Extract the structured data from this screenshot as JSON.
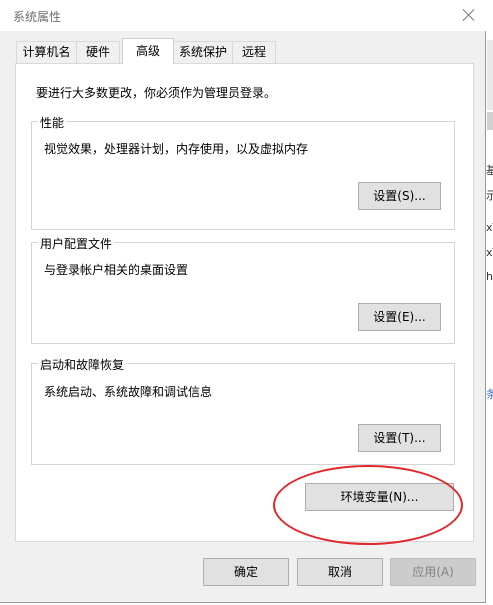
{
  "window": {
    "title": "系统属性"
  },
  "tabs": [
    {
      "label": "计算机名"
    },
    {
      "label": "硬件"
    },
    {
      "label": "高级"
    },
    {
      "label": "系统保护"
    },
    {
      "label": "远程"
    }
  ],
  "active_tab": "高级",
  "advanced": {
    "admin_note": "要进行大多数更改，你必须作为管理员登录。",
    "performance": {
      "title": "性能",
      "description": "视觉效果，处理器计划，内存使用，以及虚拟内存",
      "button": "设置(S)..."
    },
    "user_profiles": {
      "title": "用户配置文件",
      "description": "与登录帐户相关的桌面设置",
      "button": "设置(E)..."
    },
    "startup_recovery": {
      "title": "启动和故障恢复",
      "description": "系统启动、系统故障和调试信息",
      "button": "设置(T)..."
    },
    "env_vars_button": "环境变量(N)..."
  },
  "footer": {
    "ok": "确定",
    "cancel": "取消",
    "apply": "应用(A)"
  },
  "highlight_color": "#e0272b",
  "background_fragments": [
    "基",
    "示",
    "xT",
    "xT",
    "ha",
    "条"
  ]
}
